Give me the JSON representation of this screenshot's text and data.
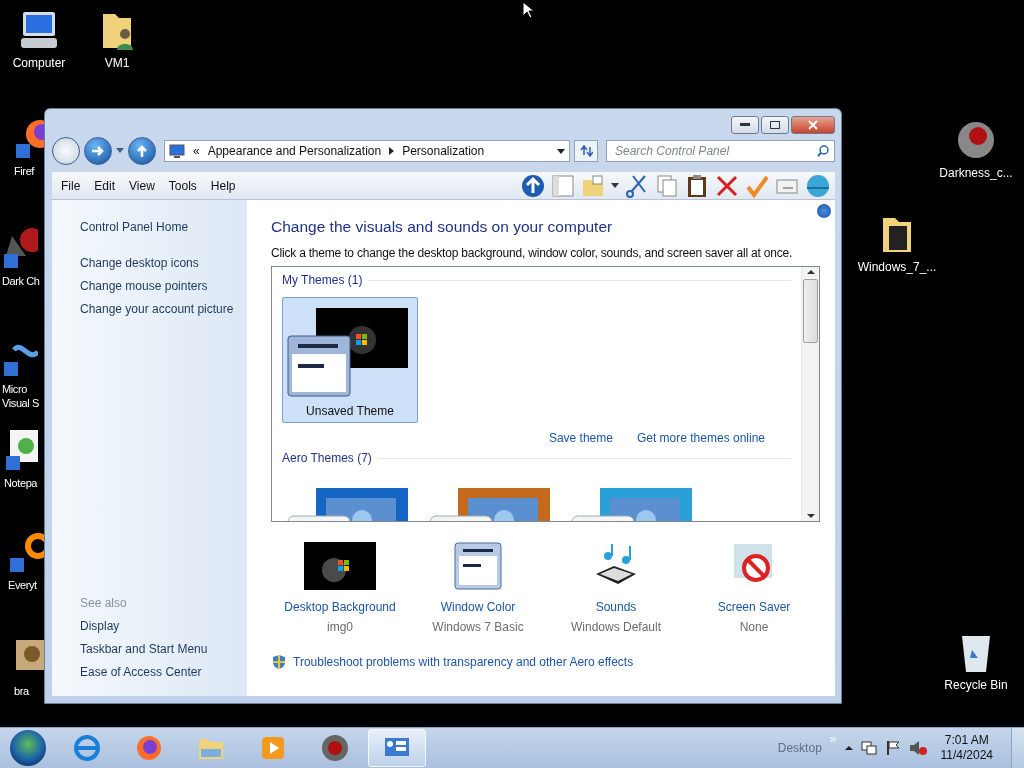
{
  "desktop_icons": [
    {
      "label": "Computer"
    },
    {
      "label": "VM1"
    },
    {
      "label": "Firef"
    },
    {
      "label": "Dark Ch"
    },
    {
      "label": "Micro\nVisual S"
    },
    {
      "label": "Notepa"
    },
    {
      "label": "Everyt"
    },
    {
      "label": "bra"
    },
    {
      "label": "Darkness_c..."
    },
    {
      "label": "Windows_7_..."
    },
    {
      "label": "Recycle Bin"
    }
  ],
  "window": {
    "address": {
      "overflow_mark": "«",
      "crumbs": [
        "Appearance and Personalization",
        "Personalization"
      ]
    },
    "search": {
      "placeholder": "Search Control Panel"
    },
    "menu": [
      "File",
      "Edit",
      "View",
      "Tools",
      "Help"
    ],
    "left_pane": {
      "links": [
        "Control Panel Home",
        "Change desktop icons",
        "Change mouse pointers",
        "Change your account picture"
      ],
      "see_also": {
        "title": "See also",
        "links": [
          "Display",
          "Taskbar and Start Menu",
          "Ease of Access Center"
        ]
      }
    },
    "main": {
      "heading": "Change the visuals and sounds on your computer",
      "subtitle": "Click a theme to change the desktop background, window color, sounds, and screen saver all at once.",
      "theme_groups": [
        {
          "title": "My Themes (1)",
          "themes": [
            {
              "name": "Unsaved Theme",
              "selected": true
            }
          ],
          "links": [
            "Save theme",
            "Get more themes online"
          ]
        },
        {
          "title": "Aero Themes (7)",
          "themes": [
            {
              "selected": false
            },
            {
              "selected": false
            },
            {
              "selected": false
            }
          ]
        }
      ],
      "settings": [
        {
          "label": "Desktop Background",
          "value": "img0"
        },
        {
          "label": "Window Color",
          "value": "Windows 7 Basic"
        },
        {
          "label": "Sounds",
          "value": "Windows Default"
        },
        {
          "label": "Screen Saver",
          "value": "None"
        }
      ],
      "troubleshoot": "Troubleshoot problems with transparency and other Aero effects"
    }
  },
  "taskbar": {
    "apps": [
      {
        "selected": false
      },
      {
        "selected": false
      },
      {
        "selected": false
      },
      {
        "selected": false
      },
      {
        "selected": false
      },
      {
        "selected": true
      }
    ],
    "desktop_label": "Desktop",
    "overflow": "»",
    "clock": {
      "time": "7:01 AM",
      "date": "11/4/2024"
    }
  }
}
